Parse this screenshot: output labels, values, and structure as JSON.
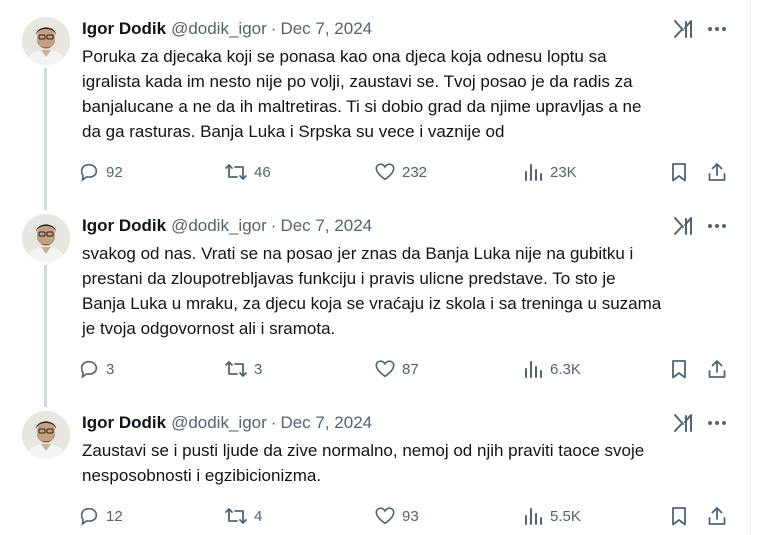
{
  "tweets": [
    {
      "name": "Igor Dodik",
      "handle": "@dodik_igor",
      "separator": "·",
      "date": "Dec 7, 2024",
      "text": "Poruka za djecaka koji se ponasa kao ona djeca koja odnesu loptu sa\nigralista kada im nesto nije po volji, zaustavi se. Tvoj posao je da radis za\nbanjalucane a ne da ih maltretiras. Ti si dobio grad da njime upravljas a ne\nda ga rasturas. Banja Luka i Srpska su vece i vaznije od",
      "replies": "92",
      "reposts": "46",
      "likes": "232",
      "views": "23K"
    },
    {
      "name": "Igor Dodik",
      "handle": "@dodik_igor",
      "separator": "·",
      "date": "Dec 7, 2024",
      "text": "svakog od nas. Vrati se na posao jer znas da Banja Luka nije na gubitku i\nprestani da zloupotrebljavas funkciju i pravis ulicne predstave. To sto je\nBanja Luka u mraku, za djecu koja se vraćaju iz skola i sa treninga u suzama\nje tvoja odgovornost ali i sramota.",
      "replies": "3",
      "reposts": "3",
      "likes": "87",
      "views": "6.3K"
    },
    {
      "name": "Igor Dodik",
      "handle": "@dodik_igor",
      "separator": "·",
      "date": "Dec 7, 2024",
      "text": "Zaustavi se i pusti ljude da zive normalno, nemoj od njih praviti taoce svoje\nnesposobnosti i egzibicionizma.",
      "replies": "12",
      "reposts": "4",
      "likes": "93",
      "views": "5.5K"
    }
  ],
  "icons": {
    "grok": "grok-icon",
    "more": "more-icon",
    "reply": "reply-icon",
    "repost": "repost-icon",
    "like": "like-icon",
    "views": "views-icon",
    "bookmark": "bookmark-icon",
    "share": "share-icon"
  },
  "colors": {
    "text": "#0f1419",
    "secondary": "#536471",
    "thread_line": "#cfd9de"
  }
}
